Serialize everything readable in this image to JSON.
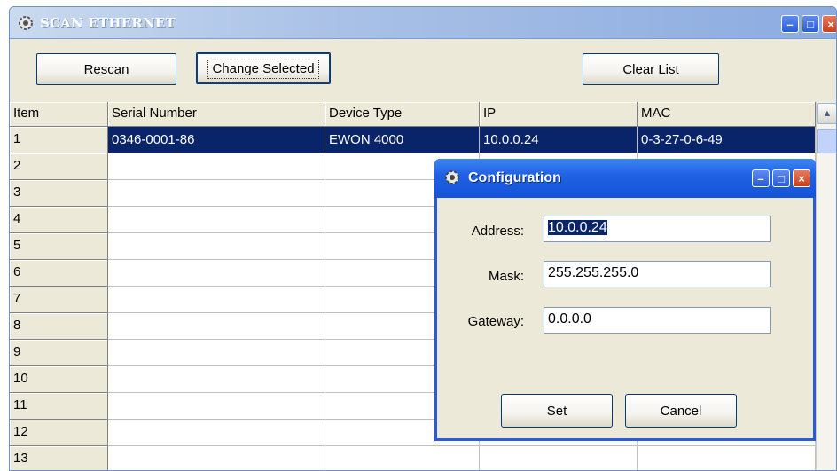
{
  "window": {
    "title": "SCAN ETHERNET",
    "buttons": {
      "rescan": "Rescan",
      "change_selected": "Change Selected",
      "clear_list": "Clear List"
    }
  },
  "grid": {
    "columns": [
      "Item",
      "Serial Number",
      "Device Type",
      "IP",
      "MAC"
    ],
    "rows": [
      {
        "item": "1",
        "serial": "0346-0001-86",
        "type": "EWON 4000",
        "ip": "10.0.0.24",
        "mac": "0-3-27-0-6-49"
      },
      {
        "item": "2",
        "serial": "",
        "type": "",
        "ip": "",
        "mac": ""
      },
      {
        "item": "3",
        "serial": "",
        "type": "",
        "ip": "",
        "mac": ""
      },
      {
        "item": "4",
        "serial": "",
        "type": "",
        "ip": "",
        "mac": ""
      },
      {
        "item": "5",
        "serial": "",
        "type": "",
        "ip": "",
        "mac": ""
      },
      {
        "item": "6",
        "serial": "",
        "type": "",
        "ip": "",
        "mac": ""
      },
      {
        "item": "7",
        "serial": "",
        "type": "",
        "ip": "",
        "mac": ""
      },
      {
        "item": "8",
        "serial": "",
        "type": "",
        "ip": "",
        "mac": ""
      },
      {
        "item": "9",
        "serial": "",
        "type": "",
        "ip": "",
        "mac": ""
      },
      {
        "item": "10",
        "serial": "",
        "type": "",
        "ip": "",
        "mac": ""
      },
      {
        "item": "11",
        "serial": "",
        "type": "",
        "ip": "",
        "mac": ""
      },
      {
        "item": "12",
        "serial": "",
        "type": "",
        "ip": "",
        "mac": ""
      },
      {
        "item": "13",
        "serial": "",
        "type": "",
        "ip": "",
        "mac": ""
      }
    ],
    "selected_row": "1"
  },
  "dialog": {
    "title": "Configuration",
    "address_label": "Address:",
    "address_value": "10.0.0.24",
    "mask_label": "Mask:",
    "mask_value": "255.255.255.0",
    "gateway_label": "Gateway:",
    "gateway_value": "0.0.0.0",
    "set_label": "Set",
    "cancel_label": "Cancel"
  },
  "colors": {
    "selection": "#0a246a",
    "dialog_title": "#2062e4",
    "window_face": "#ece9d8"
  }
}
